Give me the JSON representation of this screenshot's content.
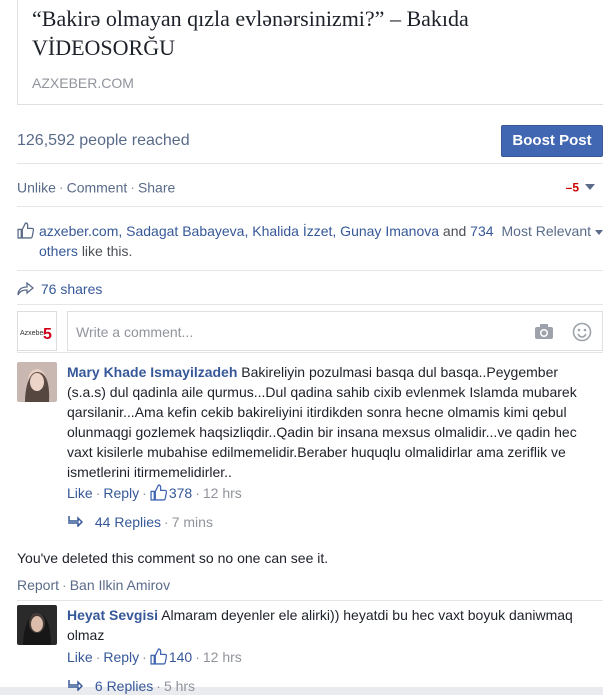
{
  "link_preview": {
    "title": "“Bakirə olmayan qızla evlənərsinizmi?” – Bakıda VİDEOSORĞU",
    "domain": "AZXEBER.COM"
  },
  "reach": {
    "text": "126,592 people reached",
    "boost_label": "Boost Post"
  },
  "actions": {
    "unlike": "Unlike",
    "comment": "Comment",
    "share": "Share",
    "separator": "·"
  },
  "likes": {
    "names": "azxeber.com, Sadagat Babayeva, Khalida İzzet, Gunay Imanova",
    "and": "and",
    "others": "734 others",
    "suffix": "like this.",
    "sort_label": "Most Relevant"
  },
  "shares": {
    "text": "76 shares"
  },
  "composer": {
    "placeholder": "Write a comment..."
  },
  "comments": [
    {
      "author": "Mary Khade Ismayilzadeh",
      "text": "Bakireliyin pozulmasi basqa dul basqa..Peygember (s.a.s) dul qadinla aile qurmus...Dul qadina sahib cixib evlenmek Islamda mubarek qarsilanir...Ama kefin cekib bakireliyini itirdikden sonra hecne olmamis kimi qebul olunmaqgi gozlemek haqsizliqdir..Qadin bir insana mexsus olmalidir...ve qadin hec vaxt kisilerle mubahise edilmemelidir.Beraber huquqlu olmalidirlar ama zeriflik ve ismetlerini itirmemelidirler..",
      "like": "Like",
      "reply": "Reply",
      "like_count": "378",
      "time": "12 hrs",
      "replies": "44 Replies",
      "replies_time": "7 mins"
    },
    {
      "author": "Heyat Sevgisi",
      "text": "Almaram deyenler ele alirki)) heyatdi bu hec vaxt boyuk daniwmaq olmaz",
      "like": "Like",
      "reply": "Reply",
      "like_count": "140",
      "time": "12 hrs",
      "replies": "6 Replies",
      "replies_time": "5 hrs"
    }
  ],
  "deleted": {
    "text": "You've deleted this comment so no one can see it.",
    "report": "Report",
    "ban": "Ban Ilkin Amirov"
  },
  "colors": {
    "link": "#365899",
    "button": "#4267b2",
    "meta": "#90949c"
  },
  "icons": [
    "thumbs-up-icon",
    "share-arrow-icon",
    "camera-icon",
    "smiley-icon",
    "reply-arrow-icon",
    "caret-down-icon"
  ]
}
